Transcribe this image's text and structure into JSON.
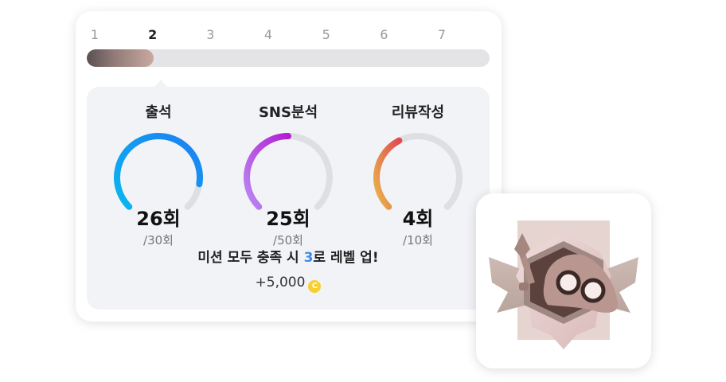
{
  "steps": [
    "1",
    "2",
    "3",
    "4",
    "5",
    "6",
    "7"
  ],
  "current_step": 2,
  "progress": {
    "fraction": 0.166,
    "colors": [
      "#5a4f52",
      "#c9a9a1"
    ]
  },
  "missions": [
    {
      "title": "출석",
      "count": "26회",
      "goal": "/30회",
      "ratio": 0.867,
      "colors": [
        "#08b7f0",
        "#1e7ff2"
      ]
    },
    {
      "title": "SNS분석",
      "count": "25회",
      "goal": "/50회",
      "ratio": 0.5,
      "colors": [
        "#b98af5",
        "#b21fd0"
      ]
    },
    {
      "title": "리뷰작성",
      "count": "4회",
      "goal": "/10회",
      "ratio": 0.4,
      "colors": [
        "#e9b64a",
        "#e04b52"
      ]
    }
  ],
  "message": {
    "before": "미션 모두 충족 시 ",
    "level": "3",
    "after": "로 레벨 업!"
  },
  "reward": {
    "amount": "+5,000",
    "icon": "coin-icon",
    "coin_glyph": "C"
  },
  "badge": {
    "icon": "mole-explorer-badge-icon"
  }
}
